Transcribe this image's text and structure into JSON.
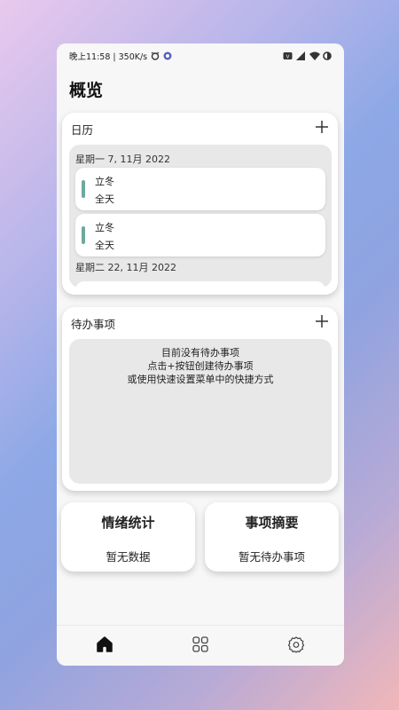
{
  "status_bar": {
    "time_speed": "晚上11:58 | 350K/s",
    "icons_left": [
      "alarm-icon",
      "app-notification-icon"
    ],
    "icons_right": [
      "vpn-icon",
      "signal-icon",
      "wifi-icon",
      "battery-icon"
    ]
  },
  "page": {
    "title": "概览"
  },
  "calendar": {
    "title": "日历",
    "add_icon": "plus-icon",
    "groups": [
      {
        "date": "星期一 7, 11月 2022",
        "events": [
          {
            "title": "立冬",
            "subtitle": "全天"
          },
          {
            "title": "立冬",
            "subtitle": "全天"
          }
        ]
      },
      {
        "date": "星期二 22, 11月 2022"
      }
    ],
    "accent": "#6fa89e"
  },
  "todo": {
    "title": "待办事项",
    "add_icon": "plus-icon",
    "empty_lines": [
      "目前没有待办事项",
      "点击+按钮创建待办事项",
      "或使用快速设置菜单中的快捷方式"
    ]
  },
  "stats": [
    {
      "title": "情绪统计",
      "value": "暂无数据"
    },
    {
      "title": "事项摘要",
      "value": "暂无待办事项"
    }
  ],
  "nav": {
    "items": [
      {
        "icon": "home-icon",
        "active": true
      },
      {
        "icon": "grid-icon",
        "active": false
      },
      {
        "icon": "settings-gear-icon",
        "active": false
      }
    ]
  }
}
